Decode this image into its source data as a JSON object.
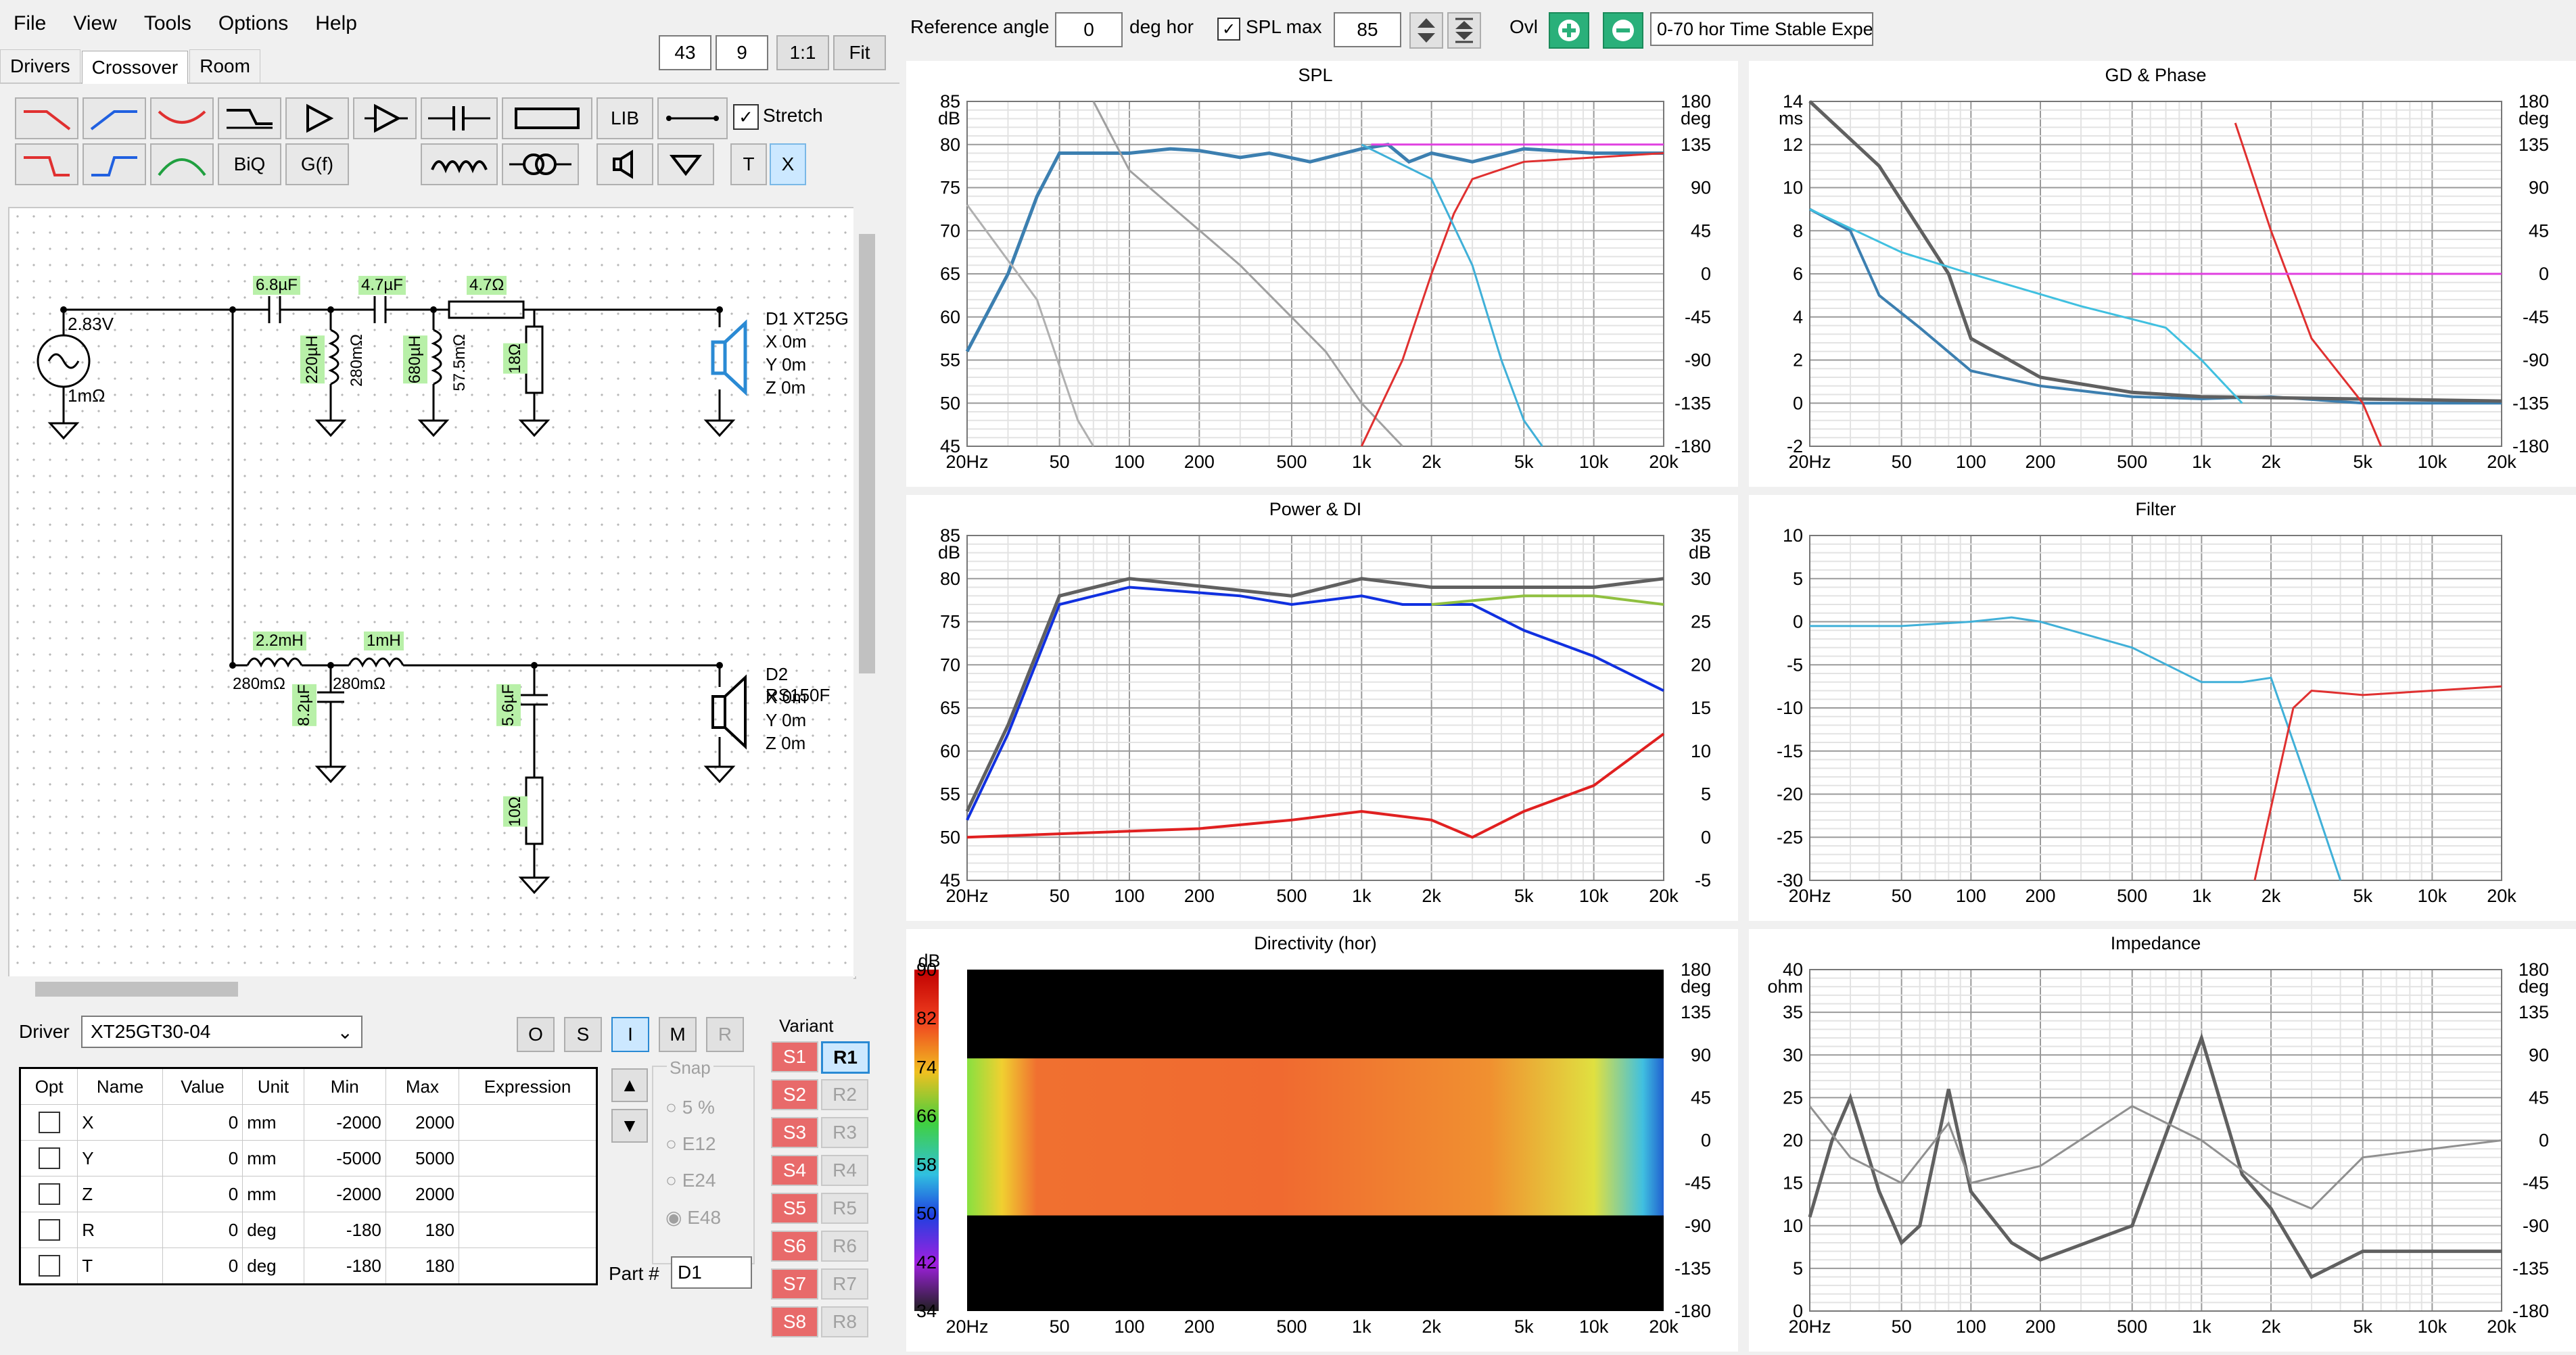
{
  "menu": [
    "File",
    "View",
    "Tools",
    "Options",
    "Help"
  ],
  "tabs": [
    "Drivers",
    "Crossover",
    "Room"
  ],
  "zoom": {
    "value1": "43",
    "value2": "9",
    "btn_11": "1:1",
    "btn_fit": "Fit"
  },
  "toolbar": {
    "lib": "LIB",
    "biq": "BiQ",
    "gf": "G(f)",
    "t": "T",
    "x": "X",
    "stretch": "Stretch"
  },
  "top_controls": {
    "ref_angle_label": "Reference angle",
    "ref_angle_value": "0",
    "ref_angle_unit": "deg hor",
    "splmax_label": "SPL max",
    "splmax_value": "85",
    "ovl_label": "Ovl",
    "status_text": "0-70 hor Time Stable Expe"
  },
  "schematic": {
    "source_voltage": "2.83V",
    "source_res": "1mΩ",
    "c1": "6.8µF",
    "c2": "4.7µF",
    "r_series": "4.7Ω",
    "l1": "220µH",
    "l1_r": "280mΩ",
    "l2": "680µH",
    "l2_r": "57.5mΩ",
    "r_shunt": "18Ω",
    "d1_name": "D1 XT25G",
    "d1_x": "X 0m",
    "d1_y": "Y 0m",
    "d1_z": "Z 0m",
    "l3": "2.2mH",
    "l3_r": "280mΩ",
    "l4": "1mH",
    "l4_r": "280mΩ",
    "c3": "8.2µF",
    "c4": "5.6µF",
    "r4": "10Ω",
    "d2_name": "D2 RS150F",
    "d2_x": "X 0m",
    "d2_y": "Y 0m",
    "d2_z": "Z 0m"
  },
  "driver_panel": {
    "driver_label": "Driver",
    "driver_value": "XT25GT30-04",
    "mode_buttons": [
      "O",
      "S",
      "I",
      "M",
      "R"
    ],
    "table_headers": [
      "Opt",
      "Name",
      "Value",
      "Unit",
      "Min",
      "Max",
      "Expression"
    ],
    "rows": [
      {
        "name": "X",
        "value": "0",
        "unit": "mm",
        "min": "-2000",
        "max": "2000"
      },
      {
        "name": "Y",
        "value": "0",
        "unit": "mm",
        "min": "-5000",
        "max": "5000"
      },
      {
        "name": "Z",
        "value": "0",
        "unit": "mm",
        "min": "-2000",
        "max": "2000"
      },
      {
        "name": "R",
        "value": "0",
        "unit": "deg",
        "min": "-180",
        "max": "180"
      },
      {
        "name": "T",
        "value": "0",
        "unit": "deg",
        "min": "-180",
        "max": "180"
      }
    ],
    "snap_label": "Snap",
    "snap_options": [
      "5 %",
      "E12",
      "E24",
      "E48"
    ],
    "part_label": "Part #",
    "part_value": "D1",
    "variant_label": "Variant",
    "variants_s": [
      "S1",
      "S2",
      "S3",
      "S4",
      "S5",
      "S6",
      "S7",
      "S8"
    ],
    "variants_r": [
      "R1",
      "R2",
      "R3",
      "R4",
      "R5",
      "R6",
      "R7",
      "R8"
    ]
  },
  "freq_ticks": [
    "20Hz",
    "50",
    "100",
    "200",
    "500",
    "1k",
    "2k",
    "5k",
    "10k",
    "20k"
  ],
  "charts": {
    "spl": {
      "title": "SPL",
      "left_unit": "dB",
      "right_unit": "deg",
      "left_ticks": [
        "85",
        "80",
        "75",
        "70",
        "65",
        "60",
        "55",
        "50",
        "45"
      ],
      "right_ticks": [
        "180",
        "135",
        "90",
        "45",
        "0",
        "-45",
        "-90",
        "-135",
        "-180"
      ]
    },
    "gd": {
      "title": "GD & Phase",
      "left_unit": "ms",
      "right_unit": "deg",
      "left_ticks": [
        "14",
        "12",
        "10",
        "8",
        "6",
        "4",
        "2",
        "0",
        "-2"
      ],
      "right_ticks": [
        "180",
        "135",
        "90",
        "45",
        "0",
        "-45",
        "-90",
        "-135",
        "-180"
      ]
    },
    "power": {
      "title": "Power & DI",
      "left_unit": "dB",
      "right_unit": "dB",
      "left_ticks": [
        "85",
        "80",
        "75",
        "70",
        "65",
        "60",
        "55",
        "50",
        "45"
      ],
      "right_ticks": [
        "35",
        "30",
        "25",
        "20",
        "15",
        "10",
        "5",
        "0",
        "-5"
      ]
    },
    "filter": {
      "title": "Filter",
      "left_unit": "",
      "left_ticks": [
        "10",
        "5",
        "0",
        "-5",
        "-10",
        "-15",
        "-20",
        "-25",
        "-30"
      ]
    },
    "directivity": {
      "title": "Directivity (hor)",
      "left_unit": "dB",
      "right_unit": "deg",
      "scale_ticks": [
        "90",
        "82",
        "74",
        "66",
        "58",
        "50",
        "42",
        "34"
      ],
      "right_ticks": [
        "180",
        "135",
        "90",
        "45",
        "0",
        "-45",
        "-90",
        "-135",
        "-180"
      ]
    },
    "impedance": {
      "title": "Impedance",
      "left_unit": "ohm",
      "right_unit": "deg",
      "left_ticks": [
        "40",
        "35",
        "30",
        "25",
        "20",
        "15",
        "10",
        "5",
        "0"
      ],
      "right_ticks": [
        "180",
        "135",
        "90",
        "45",
        "0",
        "-45",
        "-90",
        "-135",
        "-180"
      ]
    }
  },
  "colors": {
    "accent": "#2a8ad4",
    "grid": "#9a9a9a",
    "teal": "#3ab6d8",
    "red": "#e03030",
    "magenta": "#e040e0",
    "gray": "#707070"
  }
}
